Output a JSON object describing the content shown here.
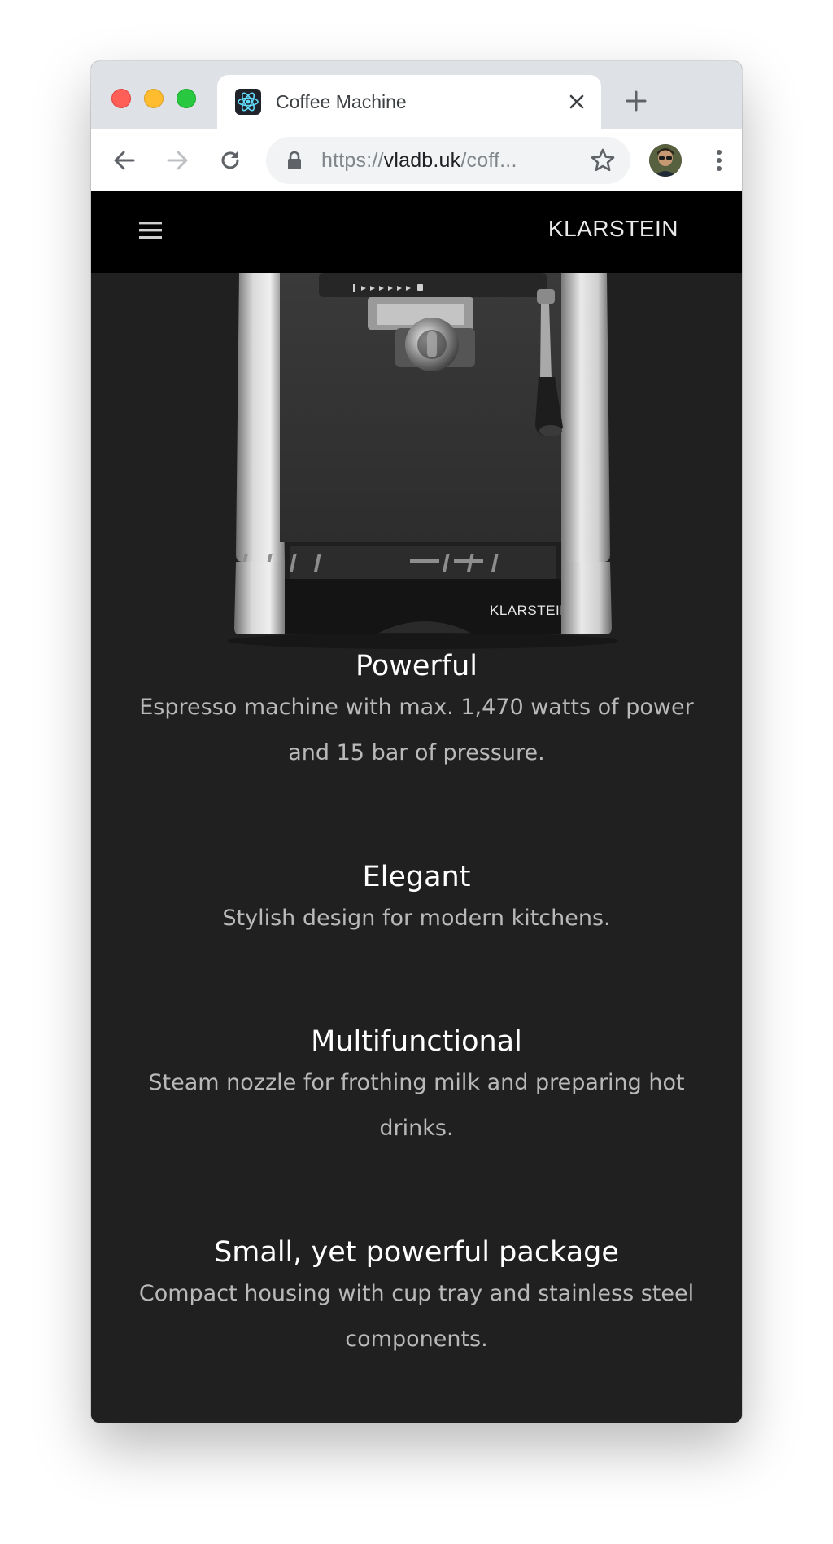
{
  "browser": {
    "tab": {
      "title": "Coffee Machine",
      "favicon": "react-logo-icon",
      "close_icon": "close-icon"
    },
    "new_tab_icon": "plus-icon",
    "toolbar": {
      "back_icon": "arrow-left-icon",
      "forward_icon": "arrow-right-icon",
      "reload_icon": "reload-icon",
      "url_scheme": "https://",
      "url_host": "vladb.uk",
      "url_path": "/coff...",
      "lock_icon": "lock-icon",
      "bookmark_icon": "star-icon",
      "menu_icon": "more-vertical-icon"
    }
  },
  "site": {
    "header": {
      "menu_icon": "hamburger-icon",
      "brand": "KLARSTEIN"
    },
    "product_image": {
      "brand_on_machine": "KLARSTEIN"
    },
    "features": [
      {
        "title": "Powerful",
        "description": "Espresso machine with max. 1,470 watts of power and 15 bar of pressure."
      },
      {
        "title": "Elegant",
        "description": "Stylish design for modern kitchens."
      },
      {
        "title": "Multifunctional",
        "description": "Steam nozzle for frothing milk and preparing hot drinks."
      },
      {
        "title": "Small, yet powerful package",
        "description": "Compact housing with cup tray and stainless steel components."
      }
    ]
  },
  "colors": {
    "page_background": "#202020",
    "header_background": "#000000",
    "feature_title": "#ffffff",
    "feature_text": "#b9b9b9",
    "tabstrip": "#dee1e6"
  }
}
